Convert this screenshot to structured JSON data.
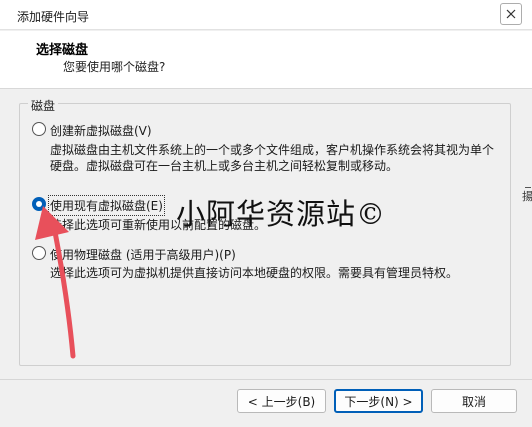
{
  "window": {
    "title": "添加硬件向导"
  },
  "header": {
    "title": "选择磁盘",
    "subtitle": "您要使用哪个磁盘?"
  },
  "group": {
    "label": "磁盘"
  },
  "options": [
    {
      "label": "创建新虚拟磁盘(V)",
      "checked": false,
      "desc_line1": "虚拟磁盘由主机文件系统上的一个或多个文件组成，客户机操作系统会将其视为单个",
      "desc_line2": "硬盘。虚拟磁盘可在一台主机上或多台主机之间轻松复制或移动。"
    },
    {
      "label": "使用现有虚拟磁盘(E)",
      "checked": true,
      "desc_line1": "选择此选项可重新使用以前配置的磁盘。"
    },
    {
      "label": "使用物理磁盘 (适用于高级用户)(P)",
      "checked": false,
      "desc_line1": "选择此选项可为虚拟机提供直接访问本地硬盘的权限。需要具有管理员特权。"
    }
  ],
  "watermark": "小阿华资源站©",
  "edge_text": "揚",
  "buttons": {
    "back": "< 上一步(B)",
    "next": "下一步(N) >",
    "cancel": "取消"
  },
  "colors": {
    "accent": "#005fb8",
    "arrow": "#e8505b"
  }
}
